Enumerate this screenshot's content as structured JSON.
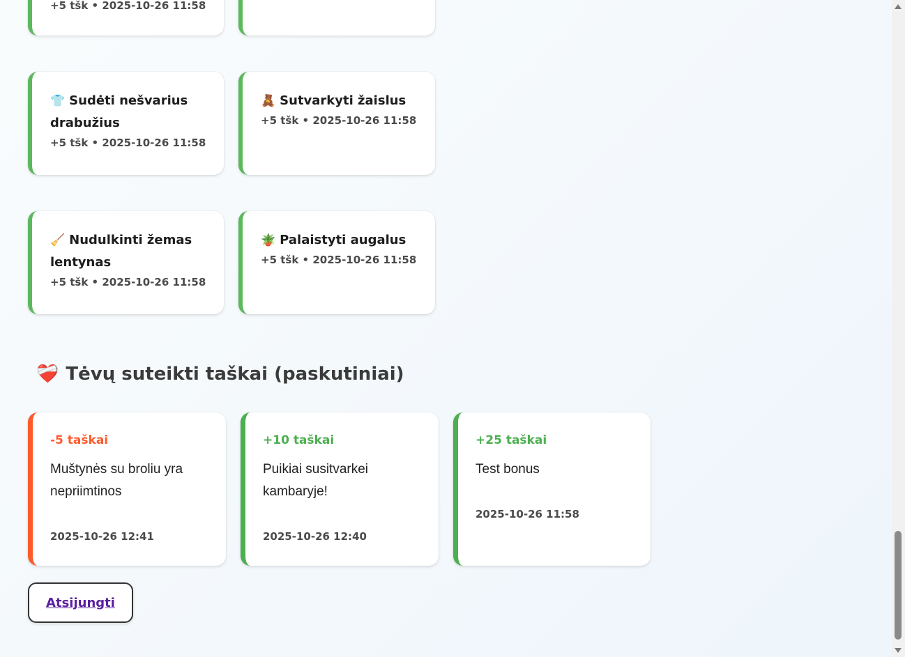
{
  "tasks": [
    {
      "emoji": "",
      "title": "",
      "meta": "+5 tšk • 2025-10-26 11:58"
    },
    {
      "emoji": "",
      "title": "",
      "meta": ""
    },
    {
      "emoji": "👕",
      "title": "Sudėti nešvarius drabužius",
      "meta": "+5 tšk • 2025-10-26 11:58"
    },
    {
      "emoji": "🧸",
      "title": "Sutvarkyti žaislus",
      "meta": "+5 tšk • 2025-10-26 11:58"
    },
    {
      "emoji": "🧹",
      "title": "Nudulkinti žemas lentynas",
      "meta": "+5 tšk • 2025-10-26 11:58"
    },
    {
      "emoji": "🪴",
      "title": "Palaistyti augalus",
      "meta": "+5 tšk • 2025-10-26 11:58"
    }
  ],
  "bonus_section": {
    "icon": "❤️‍🩹",
    "title": "Tėvų suteikti taškai (paskutiniai)",
    "items": [
      {
        "points": "-5 taškai",
        "message": "Muštynės su broliu yra nepriimtinos",
        "date": "2025-10-26 12:41",
        "color": "#ff5a2c"
      },
      {
        "points": "+10 taškai",
        "message": "Puikiai susitvarkei kambaryje!",
        "date": "2025-10-26 12:40",
        "color": "#4caf50"
      },
      {
        "points": "+25 taškai",
        "message": "Test bonus",
        "date": "2025-10-26 11:58",
        "color": "#4caf50"
      }
    ]
  },
  "logout_label": "Atsijungti",
  "colors": {
    "accent_green": "#5cb85c",
    "negative": "#ff5a2c",
    "link": "#5a1fa0"
  }
}
